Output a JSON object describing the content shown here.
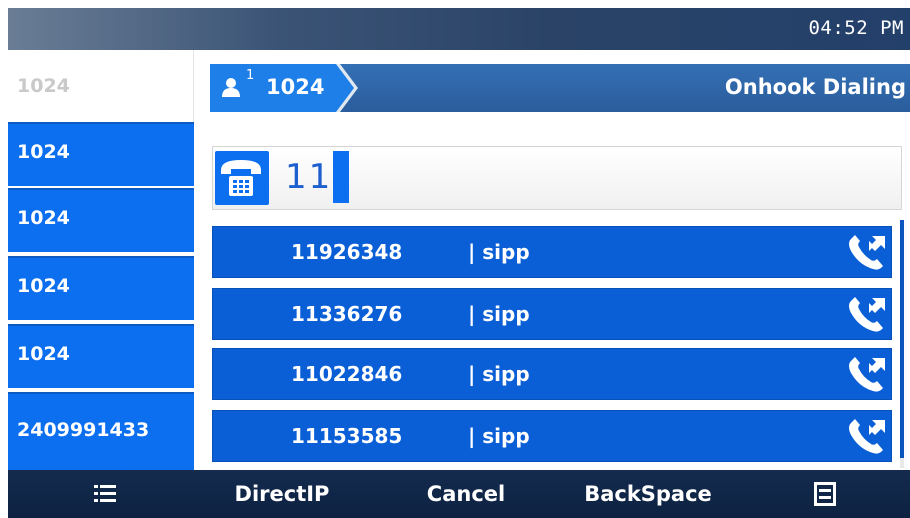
{
  "status_bar": {
    "time": "04:52 PM"
  },
  "accounts": [
    {
      "label": "1024",
      "state": "active"
    },
    {
      "label": "1024",
      "state": "normal"
    },
    {
      "label": "1024",
      "state": "normal"
    },
    {
      "label": "1024",
      "state": "normal"
    },
    {
      "label": "1024",
      "state": "normal"
    },
    {
      "label": "2409991433",
      "state": "normal"
    }
  ],
  "header": {
    "line_number": "1",
    "account": "1024",
    "title": "Onhook Dialing",
    "icon": "person-icon"
  },
  "dial": {
    "icon": "desk-phone-icon",
    "digits": "11"
  },
  "suggestions": [
    {
      "number": "11926348",
      "separator": "|",
      "account": "sipp",
      "icon": "call-history-icon"
    },
    {
      "number": "11336276",
      "separator": "|",
      "account": "sipp",
      "icon": "call-history-icon"
    },
    {
      "number": "11022846",
      "separator": "|",
      "account": "sipp",
      "icon": "call-history-icon"
    },
    {
      "number": "11153585",
      "separator": "|",
      "account": "sipp",
      "icon": "call-history-icon"
    }
  ],
  "softkeys": {
    "left_icon": "list-menu-icon",
    "directip": "DirectIP",
    "cancel": "Cancel",
    "backspace": "BackSpace",
    "right_icon": "menu-icon"
  },
  "colors": {
    "accent_blue": "#0c6ff0",
    "row_blue": "#0a5fd6",
    "header_blue": "#2a5d9c",
    "softkey_bar": "#0d2242",
    "dial_digits": "#1e5fcf"
  }
}
